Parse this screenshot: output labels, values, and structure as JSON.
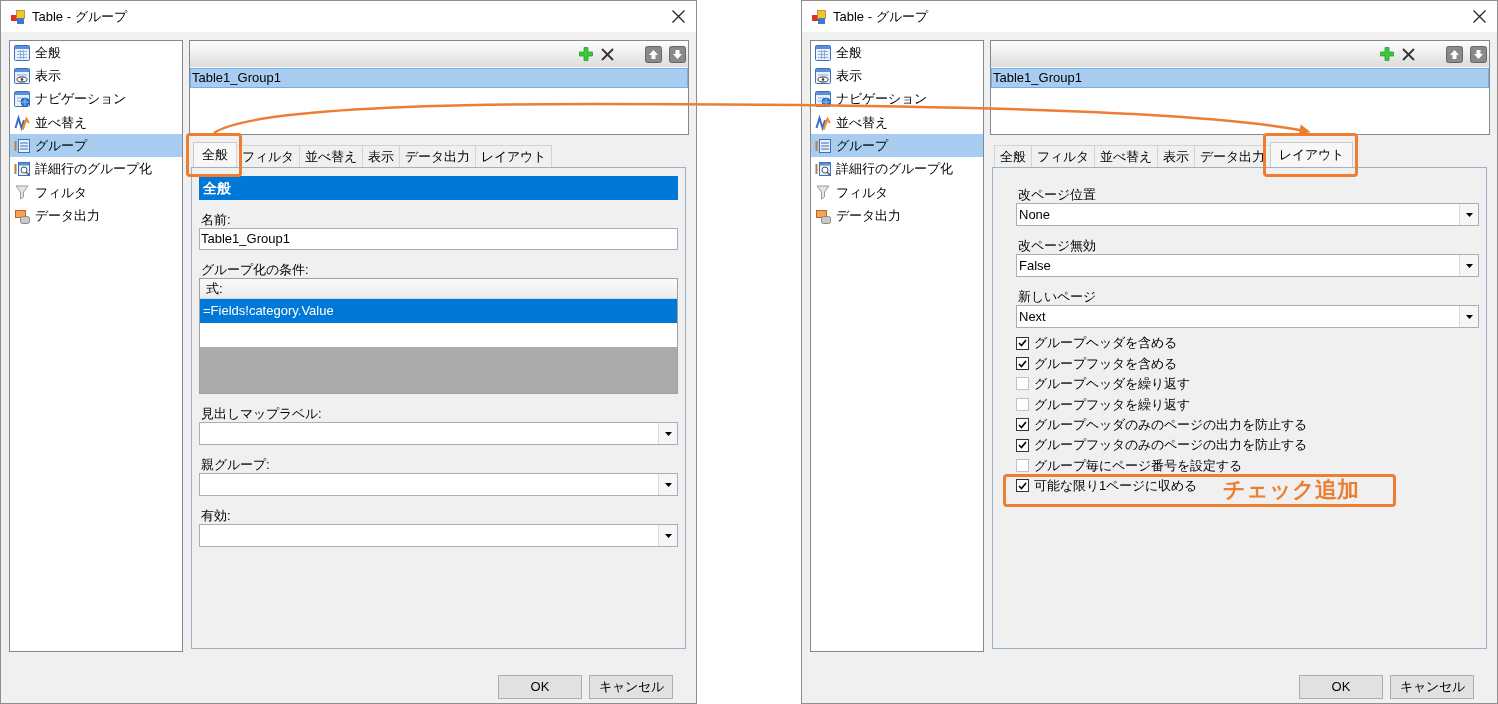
{
  "dialogs": [
    {
      "title": "Table - グループ",
      "sidebar": {
        "items": [
          {
            "label": "全般",
            "selected": false
          },
          {
            "label": "表示",
            "selected": false
          },
          {
            "label": "ナビゲーション",
            "selected": false
          },
          {
            "label": "並べ替え",
            "selected": false
          },
          {
            "label": "グループ",
            "selected": true
          },
          {
            "label": "詳細行のグループ化",
            "selected": false
          },
          {
            "label": "フィルタ",
            "selected": false
          },
          {
            "label": "データ出力",
            "selected": false
          }
        ]
      },
      "group_list": {
        "items": [
          {
            "label": "Table1_Group1",
            "selected": true
          }
        ]
      },
      "tabs": [
        {
          "label": "全般",
          "selected": true,
          "highlighted": true
        },
        {
          "label": "フィルタ",
          "selected": false,
          "highlighted": false
        },
        {
          "label": "並べ替え",
          "selected": false,
          "highlighted": false
        },
        {
          "label": "表示",
          "selected": false,
          "highlighted": false
        },
        {
          "label": "データ出力",
          "selected": false,
          "highlighted": false
        },
        {
          "label": "レイアウト",
          "selected": false,
          "highlighted": false
        }
      ],
      "panel": {
        "kind": "general",
        "header": "全般",
        "fields": [
          {
            "kind": "text",
            "label": "名前:",
            "value": "Table1_Group1"
          },
          {
            "kind": "grid",
            "label": "グループ化の条件:",
            "column": "式:",
            "rows": [
              {
                "value": "=Fields!category.Value",
                "selected": true
              }
            ]
          },
          {
            "kind": "combo",
            "label": "見出しマップラベル:"
          },
          {
            "kind": "combo",
            "label": "親グループ:"
          },
          {
            "kind": "combo",
            "label": "有効:"
          }
        ]
      },
      "buttons": [
        "OK",
        "キャンセル"
      ]
    },
    {
      "title": "Table - グループ",
      "sidebar": {
        "items": [
          {
            "label": "全般",
            "selected": false
          },
          {
            "label": "表示",
            "selected": false
          },
          {
            "label": "ナビゲーション",
            "selected": false
          },
          {
            "label": "並べ替え",
            "selected": false
          },
          {
            "label": "グループ",
            "selected": true
          },
          {
            "label": "詳細行のグループ化",
            "selected": false
          },
          {
            "label": "フィルタ",
            "selected": false
          },
          {
            "label": "データ出力",
            "selected": false
          }
        ]
      },
      "group_list": {
        "items": [
          {
            "label": "Table1_Group1",
            "selected": true
          }
        ]
      },
      "tabs": [
        {
          "label": "全般",
          "selected": false,
          "highlighted": false
        },
        {
          "label": "フィルタ",
          "selected": false,
          "highlighted": false
        },
        {
          "label": "並べ替え",
          "selected": false,
          "highlighted": false
        },
        {
          "label": "表示",
          "selected": false,
          "highlighted": false
        },
        {
          "label": "データ出力",
          "selected": false,
          "highlighted": false
        },
        {
          "label": "レイアウト",
          "selected": true,
          "highlighted": true
        }
      ],
      "panel": {
        "kind": "layout",
        "fields": [
          {
            "kind": "combo",
            "label": "改ページ位置",
            "value": "None"
          },
          {
            "kind": "combo",
            "label": "改ページ無効",
            "value": "False"
          },
          {
            "kind": "combo",
            "label": "新しいページ",
            "value": "Next"
          }
        ],
        "checkboxes": [
          {
            "label": "グループヘッダを含める",
            "checked": true,
            "highlighted": false
          },
          {
            "label": "グループフッタを含める",
            "checked": true,
            "highlighted": false
          },
          {
            "label": "グループヘッダを繰り返す",
            "checked": false,
            "highlighted": false
          },
          {
            "label": "グループフッタを繰り返す",
            "checked": false,
            "highlighted": false
          },
          {
            "label": "グループヘッダのみのページの出力を防止する",
            "checked": true,
            "highlighted": false
          },
          {
            "label": "グループフッタのみのページの出力を防止する",
            "checked": true,
            "highlighted": false
          },
          {
            "label": "グループ毎にページ番号を設定する",
            "checked": false,
            "highlighted": false
          },
          {
            "label": "可能な限り1ページに収める",
            "checked": true,
            "highlighted": true,
            "callout": "チェック追加"
          }
        ]
      },
      "buttons": [
        "OK",
        "キャンセル"
      ]
    }
  ],
  "connector_arrow": true
}
